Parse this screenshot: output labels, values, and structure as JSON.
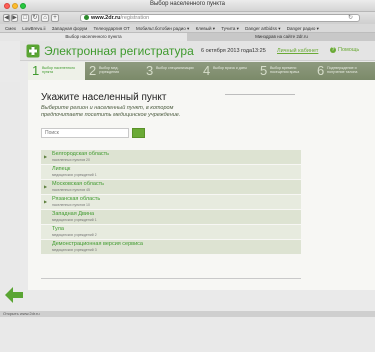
{
  "window": {
    "title": "Выбор населенного пункта"
  },
  "toolbar": {
    "url_host": "www.2dr.ru",
    "url_rest": "/registration"
  },
  "bookmarks": [
    "Смех",
    "LowBrevu.ii",
    "Западная форум",
    "Телеоударгия ОТ",
    "Мобильт.ботобин радио ▾",
    "Клевый ▾",
    "Тучита ▾",
    "Danger artbidss ▾",
    "Danger радио ▾"
  ],
  "tabs": {
    "active": "Выбор населенного пункта",
    "other": "Минздрав на сайте 2dr.ru"
  },
  "header": {
    "site_title": "Электронная регистратура",
    "date": "6 октября 2013 года",
    "time": "13:25",
    "cabinet": "Личный кабинет",
    "help": "Помощь",
    "help_mark": "?"
  },
  "steps": [
    {
      "num": "1",
      "label": "Выбор населенного пункта"
    },
    {
      "num": "2",
      "label": "Выбор мед. учреждения"
    },
    {
      "num": "3",
      "label": "Выбор специализации"
    },
    {
      "num": "4",
      "label": "Выбор врача и даты"
    },
    {
      "num": "5",
      "label": "Выбор времени посещения врача"
    },
    {
      "num": "6",
      "label": "Подтверждение и получение талона"
    }
  ],
  "content": {
    "title": "Укажите населенный пункт",
    "subtitle": "Выберите регион и населенный пункт, в котором предпочитаете посетить медицинское учреждение.",
    "search_placeholder": "Поиск"
  },
  "regions": [
    {
      "name": "Белгородская область",
      "count": "населенных пунктов 20"
    },
    {
      "name": "Липецк",
      "count": "медицинских учреждений 1"
    },
    {
      "name": "Московская область",
      "count": "населенных пунктов 45"
    },
    {
      "name": "Рязанская область",
      "count": "населенных пунктов 10"
    },
    {
      "name": "Западная Двина",
      "count": "медицинских учреждений 1"
    },
    {
      "name": "Тула",
      "count": "медицинских учреждений 2"
    },
    {
      "name": "Демонстрационная версия сервиса",
      "count": "медицинских учреждений 3"
    }
  ],
  "status": "Открыть www.2dr.ru"
}
